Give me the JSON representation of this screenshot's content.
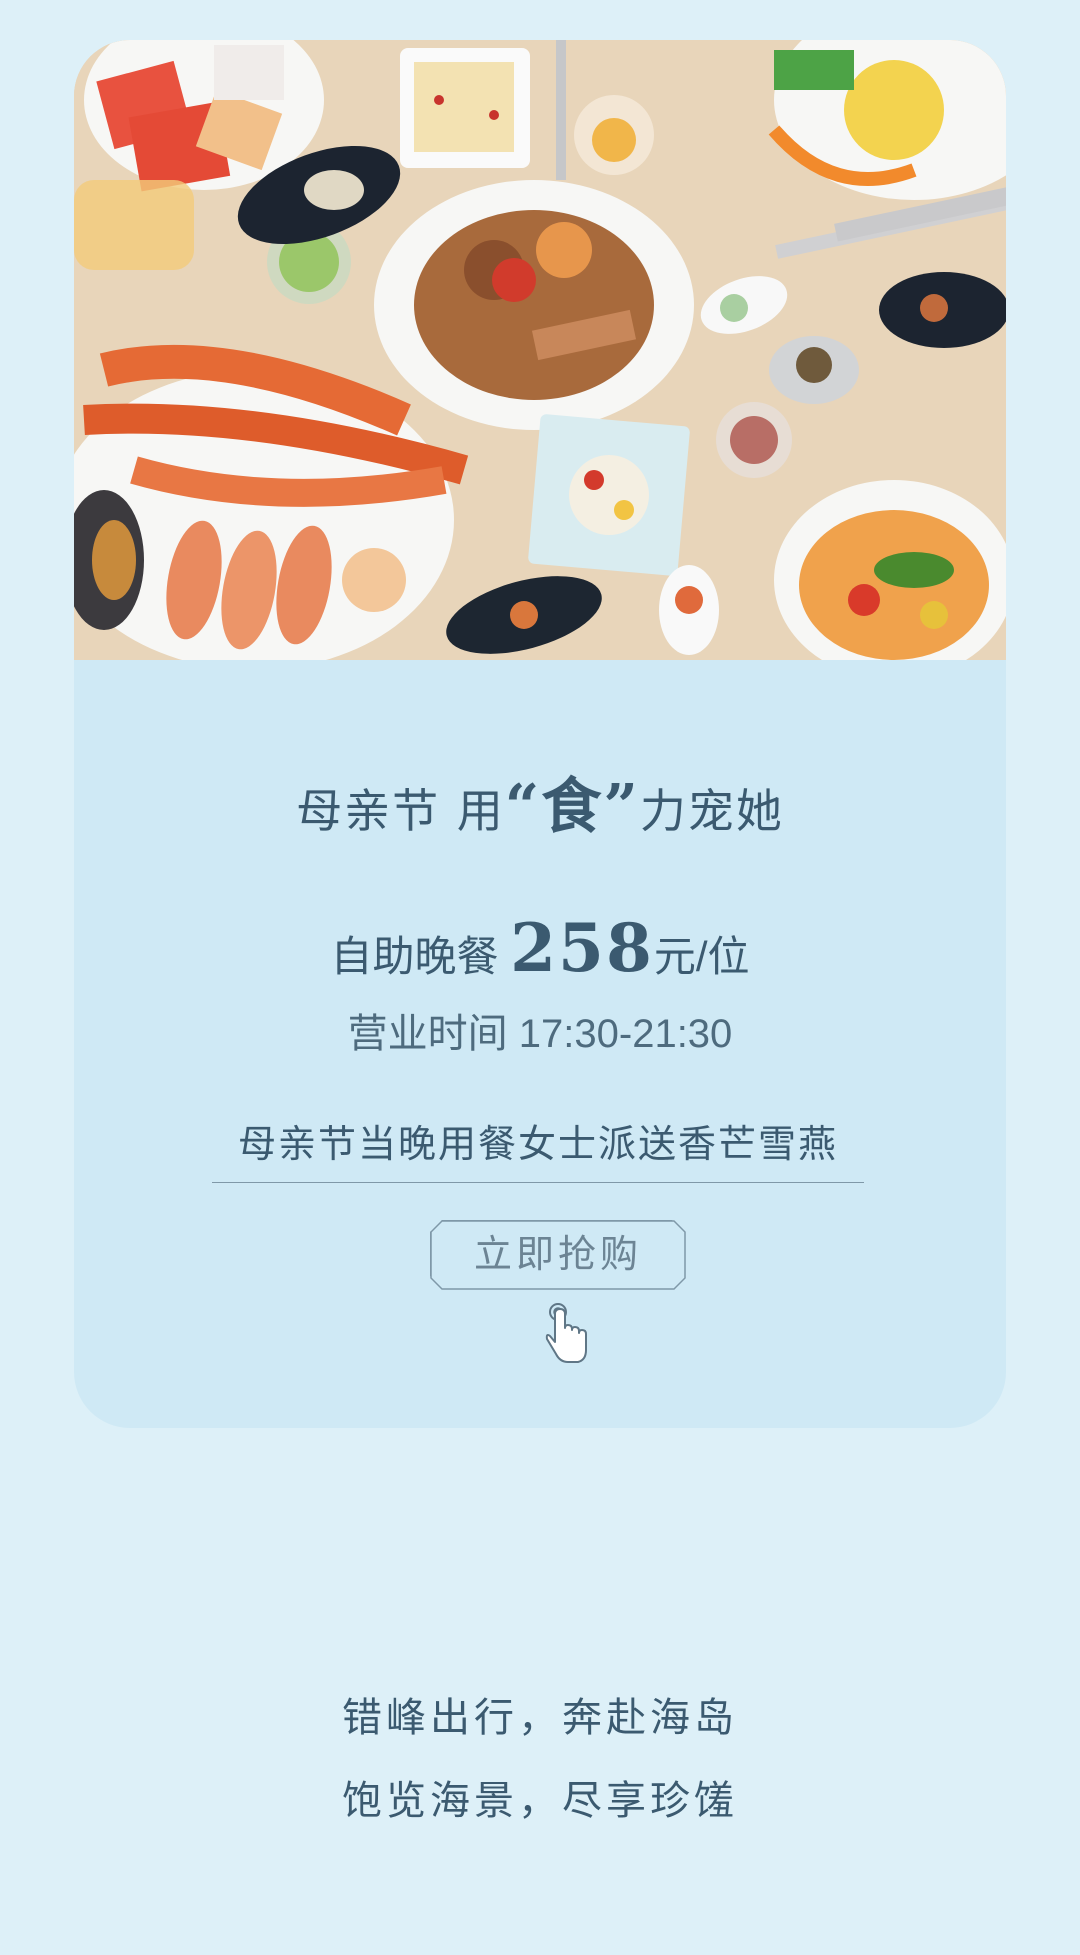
{
  "photo": {
    "icon": "buffet-food-photo"
  },
  "headline": {
    "prefix": "母亲节 用",
    "open_quote": "“",
    "quoted_word": "食",
    "close_quote": "”",
    "suffix": "力宠她"
  },
  "price": {
    "label": "自助晚餐 ",
    "amount": "258",
    "unit": "元/位"
  },
  "hours": {
    "text": "营业时间 17:30-21:30"
  },
  "gift": {
    "text": "母亲节当晚用餐女士派送香芒雪燕"
  },
  "buy_button": {
    "label": "立即抢购"
  },
  "taglines": {
    "line1": "错峰出行，奔赴海岛",
    "line2": "饱览海景，尽享珍馐"
  },
  "colors": {
    "page_bg": "#ddf0f8",
    "card_bg": "#cfe9f5",
    "text": "#3b5a70"
  }
}
